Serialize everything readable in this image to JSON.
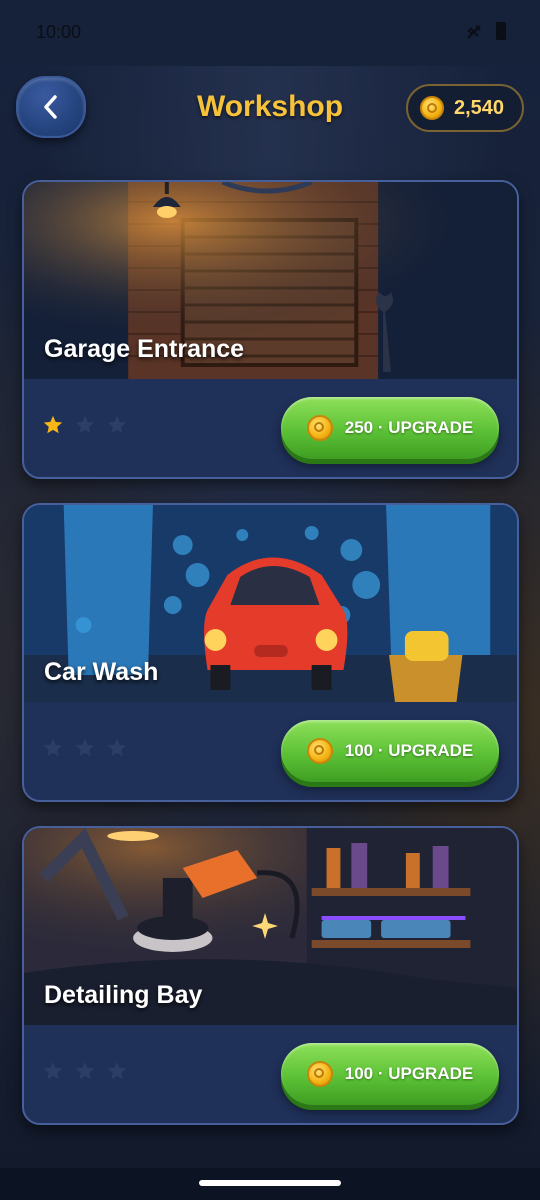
{
  "status": {
    "time": "10:00"
  },
  "header": {
    "title": "Workshop",
    "coins": "2,540"
  },
  "cards": [
    {
      "name": "Garage Entrance",
      "price": "250",
      "button_label": "250 · UPGRADE",
      "stars_filled": 1,
      "stars_total": 3
    },
    {
      "name": "Car Wash",
      "price": "100",
      "button_label": "100 · UPGRADE",
      "stars_filled": 0,
      "stars_total": 3
    },
    {
      "name": "Detailing Bay",
      "price": "100",
      "button_label": "100 · UPGRADE",
      "stars_filled": 0,
      "stars_total": 3
    }
  ],
  "colors": {
    "title": "#f5c23a",
    "star_filled": "#f6b617",
    "star_empty": "#2c3e66",
    "button_green": "#5cc136",
    "card_bg": "#1f3059"
  },
  "icons": {
    "back": "chevron-left-icon",
    "coin": "coin-icon",
    "star": "star-icon"
  }
}
